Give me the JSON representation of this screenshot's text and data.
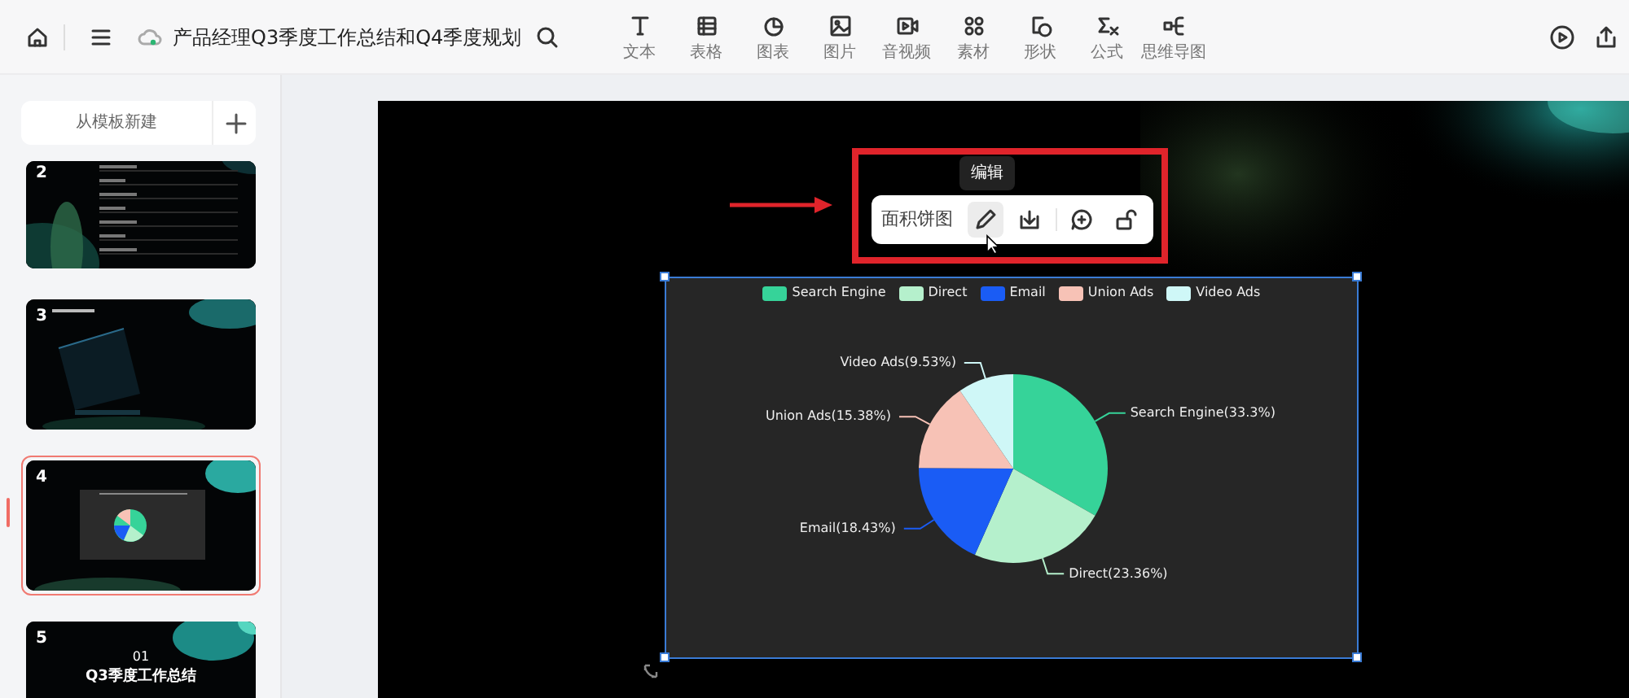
{
  "toolbar": {
    "title": "产品经理Q3季度工作总结和Q4季度规划",
    "tools": [
      {
        "label": "文本"
      },
      {
        "label": "表格"
      },
      {
        "label": "图表"
      },
      {
        "label": "图片"
      },
      {
        "label": "音视频"
      },
      {
        "label": "素材"
      },
      {
        "label": "形状"
      },
      {
        "label": "公式"
      },
      {
        "label": "思维导图"
      }
    ]
  },
  "sidebar": {
    "new_button": "从模板新建",
    "slides": [
      {
        "number": "2",
        "selected": false
      },
      {
        "number": "3",
        "selected": false
      },
      {
        "number": "4",
        "selected": true
      },
      {
        "number": "5",
        "selected": false,
        "texts": [
          "01",
          "Q3季度工作总结"
        ]
      }
    ]
  },
  "canvas": {
    "tooltip": "编辑",
    "chart_toolbar": {
      "label": "面积饼图"
    },
    "chart": {
      "legend": [
        {
          "color": "#36d399"
        },
        {
          "color": "#b5f0cc"
        },
        {
          "color": "#1a5cf5"
        },
        {
          "color": "#f7c2b6"
        },
        {
          "color": "#cff7f7"
        }
      ],
      "chart_data": {
        "type": "pie",
        "categories": [
          "Search Engine",
          "Direct",
          "Email",
          "Union Ads",
          "Video Ads"
        ],
        "values": [
          33.3,
          23.36,
          18.43,
          15.38,
          9.53
        ],
        "value_labels": [
          "Search Engine(33.3%)",
          "Direct(23.36%)",
          "Email(18.43%)",
          "Union Ads(15.38%)",
          "Video Ads(9.53%)"
        ]
      }
    }
  }
}
